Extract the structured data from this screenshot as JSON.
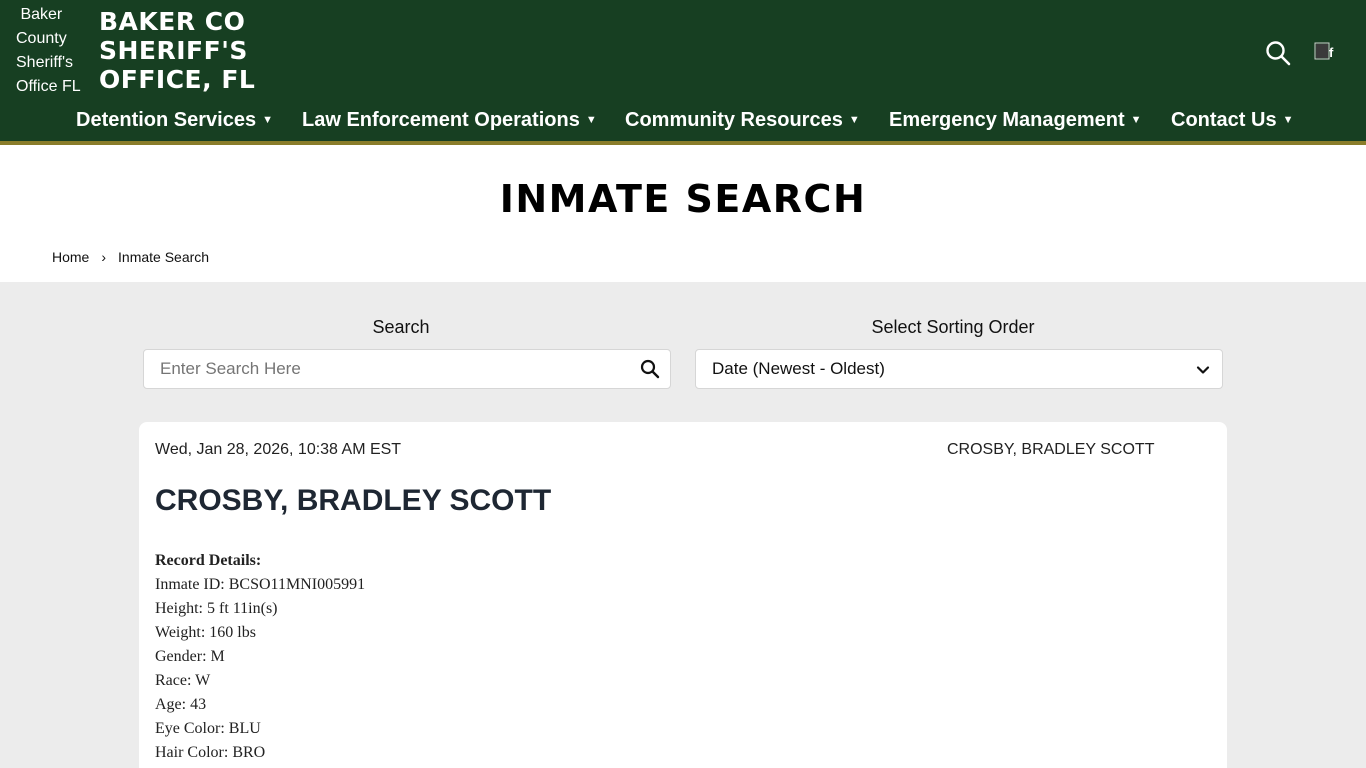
{
  "header": {
    "logo_alt": "Baker County Sheriff's Office FL",
    "site_title": "BAKER CO SHERIFF'S OFFICE, FL",
    "nav": [
      {
        "label": "Detention Services"
      },
      {
        "label": "Law Enforcement Operations"
      },
      {
        "label": "Community Resources"
      },
      {
        "label": "Emergency Management"
      },
      {
        "label": "Contact Us"
      }
    ],
    "colors": {
      "header_bg": "#173f22",
      "stripe": "#8a7d2a"
    }
  },
  "page": {
    "title": "INMATE SEARCH",
    "breadcrumb": {
      "home": "Home",
      "separator": "›",
      "current": "Inmate Search"
    }
  },
  "search": {
    "label": "Search",
    "placeholder": "Enter Search Here",
    "value": ""
  },
  "sort": {
    "label": "Select Sorting Order",
    "selected": "Date (Newest - Oldest)"
  },
  "record": {
    "date": "Wed, Jan 28, 2026, 10:38 AM EST",
    "photo_alt": "CROSBY, BRADLEY SCOTT",
    "name": "CROSBY, BRADLEY SCOTT",
    "details_heading": "Record Details:",
    "details": [
      "Inmate ID: BCSO11MNI005991",
      "Height: 5 ft 11in(s)",
      "Weight: 160 lbs",
      "Gender: M",
      "Race: W",
      "Age: 43",
      "Eye Color: BLU",
      "Hair Color: BRO"
    ]
  }
}
